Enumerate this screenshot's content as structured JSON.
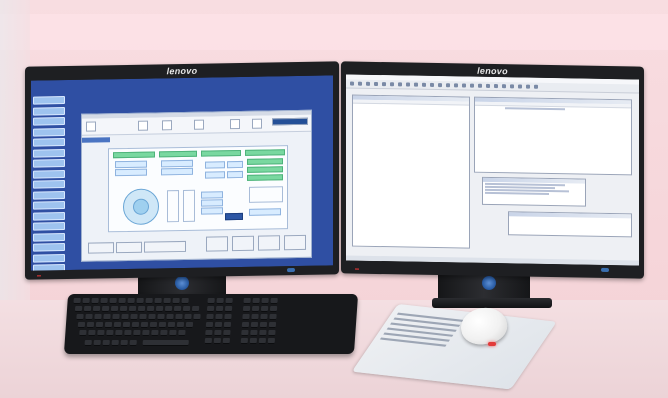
{
  "scene": {
    "background_color": "#f7d9dd",
    "desk_color": "#ecd3d7"
  },
  "left_monitor": {
    "brand": "lenovo",
    "frame_color": "#1e1f22",
    "screen_bg": "#2f4fa3",
    "sidebar_button_count": 20,
    "app_window_bg": "#eef2f8",
    "accent_green": "#79d8a0",
    "accent_blue": "#4a74c2"
  },
  "right_monitor": {
    "brand": "lenovo",
    "frame_color": "#1e1f22",
    "screen_bg": "#eef0f4",
    "panel_header": "#c9d4e8"
  },
  "keyboard": {
    "color": "#17181b"
  },
  "mouse": {
    "color": "#f1f1f1",
    "light_color": "#e23a3a"
  }
}
